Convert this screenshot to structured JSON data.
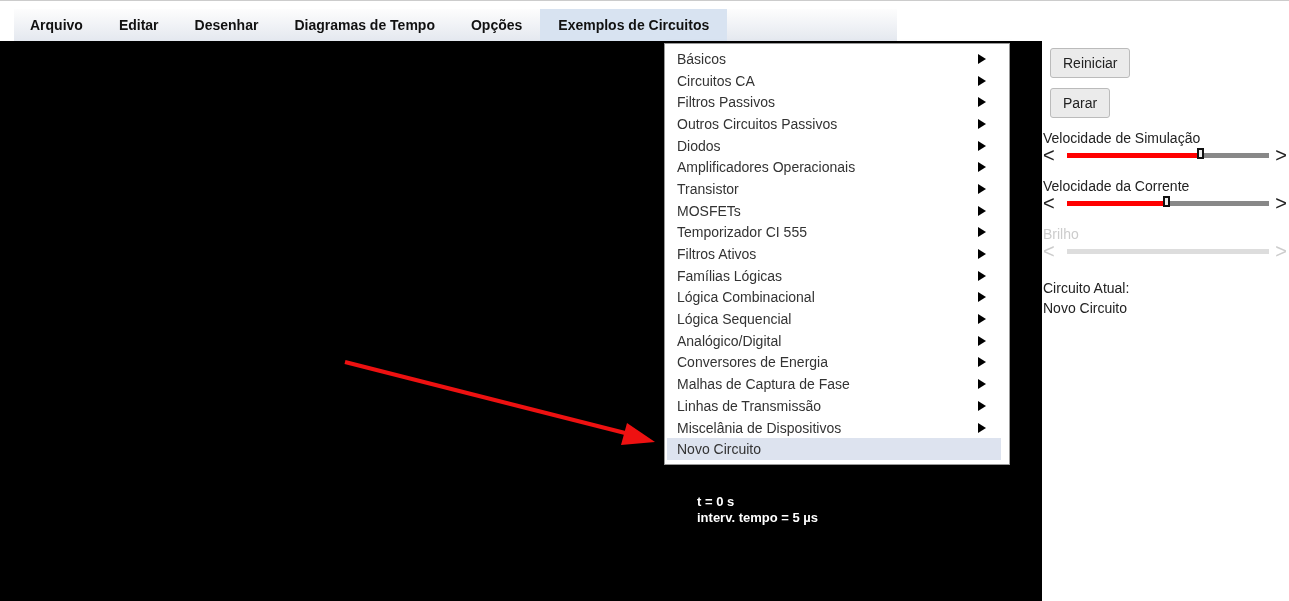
{
  "menubar": [
    {
      "label": "Arquivo",
      "selected": false
    },
    {
      "label": "Editar",
      "selected": false
    },
    {
      "label": "Desenhar",
      "selected": false
    },
    {
      "label": "Diagramas de Tempo",
      "selected": false
    },
    {
      "label": "Opções",
      "selected": false
    },
    {
      "label": "Exemplos de Circuitos",
      "selected": true
    }
  ],
  "dropdown": [
    {
      "label": "Básicos",
      "submenu": true,
      "selected": false
    },
    {
      "label": "Circuitos CA",
      "submenu": true,
      "selected": false
    },
    {
      "label": "Filtros Passivos",
      "submenu": true,
      "selected": false
    },
    {
      "label": "Outros Circuitos Passivos",
      "submenu": true,
      "selected": false
    },
    {
      "label": "Diodos",
      "submenu": true,
      "selected": false
    },
    {
      "label": "Amplificadores Operacionais",
      "submenu": true,
      "selected": false
    },
    {
      "label": "Transistor",
      "submenu": true,
      "selected": false
    },
    {
      "label": "MOSFETs",
      "submenu": true,
      "selected": false
    },
    {
      "label": "Temporizador CI 555",
      "submenu": true,
      "selected": false
    },
    {
      "label": "Filtros Ativos",
      "submenu": true,
      "selected": false
    },
    {
      "label": "Famílias Lógicas",
      "submenu": true,
      "selected": false
    },
    {
      "label": "Lógica Combinacional",
      "submenu": true,
      "selected": false
    },
    {
      "label": "Lógica Sequencial",
      "submenu": true,
      "selected": false
    },
    {
      "label": "Analógico/Digital",
      "submenu": true,
      "selected": false
    },
    {
      "label": "Conversores de Energia",
      "submenu": true,
      "selected": false
    },
    {
      "label": "Malhas de Captura de Fase",
      "submenu": true,
      "selected": false
    },
    {
      "label": "Linhas de Transmissão",
      "submenu": true,
      "selected": false
    },
    {
      "label": "Miscelânia de Dispositivos",
      "submenu": true,
      "selected": false
    },
    {
      "label": "Novo Circuito",
      "submenu": false,
      "selected": true
    }
  ],
  "canvas": {
    "info": [
      "t = 0 s",
      "interv. tempo = 5 µs"
    ]
  },
  "panel": {
    "buttons": [
      "Reiniciar",
      "Parar"
    ],
    "sliders": [
      {
        "label": "Velocidade de Simulação",
        "disabled": false,
        "level": 0.67,
        "less": "<",
        "more": ">"
      },
      {
        "label": "Velocidade da Corrente",
        "disabled": false,
        "level": 0.5,
        "less": "<",
        "more": ">"
      },
      {
        "label": "Brilho",
        "disabled": true,
        "less": "<",
        "more": ">"
      }
    ],
    "circuit_caption": "Circuito Atual:",
    "circuit_name": "Novo Circuito"
  }
}
